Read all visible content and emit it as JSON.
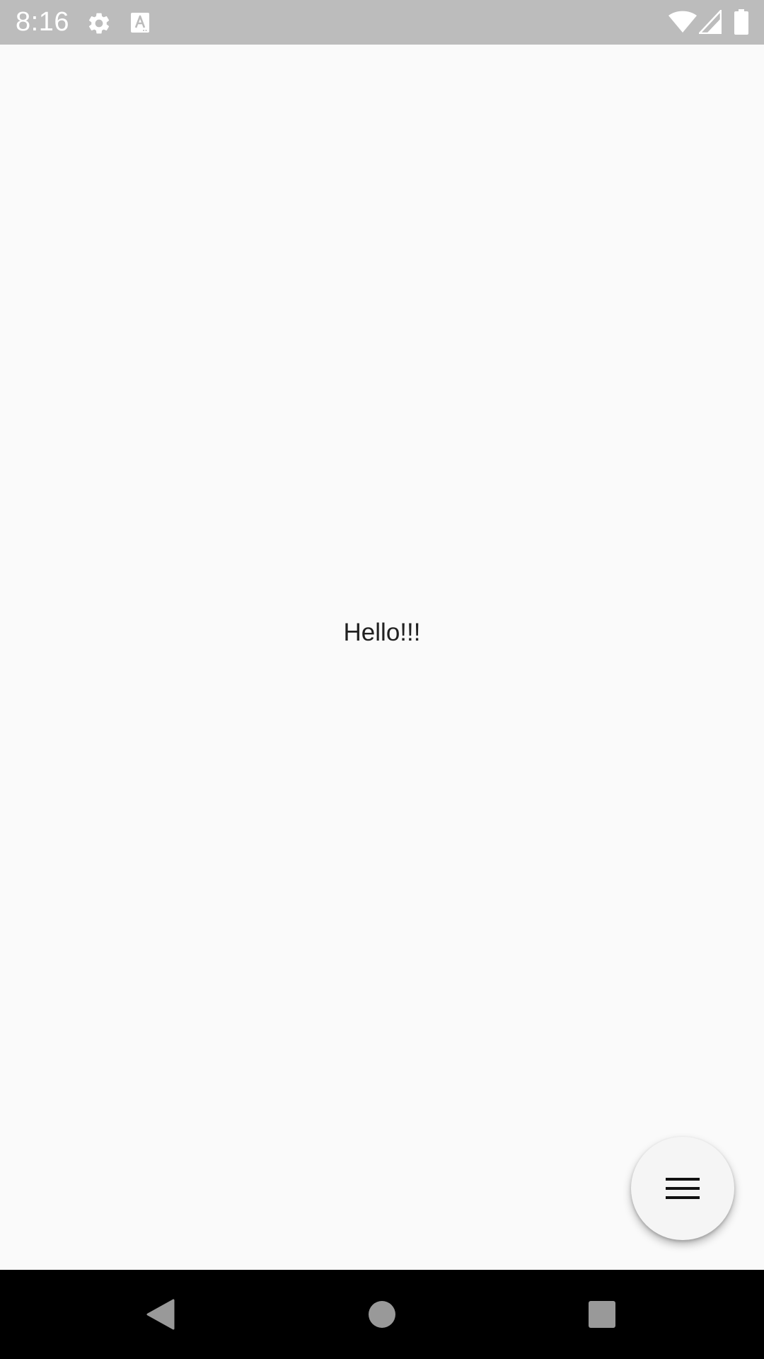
{
  "status_bar": {
    "time": "8:16",
    "icons": [
      "gear-icon",
      "a-notification-icon",
      "wifi-icon",
      "cell-signal-icon",
      "battery-icon"
    ],
    "background": "#bcbcbc"
  },
  "main": {
    "greeting": "Hello!!!"
  },
  "fab": {
    "icon": "menu-icon"
  },
  "nav_bar": {
    "buttons": [
      "back-icon",
      "home-icon",
      "recents-icon"
    ]
  }
}
